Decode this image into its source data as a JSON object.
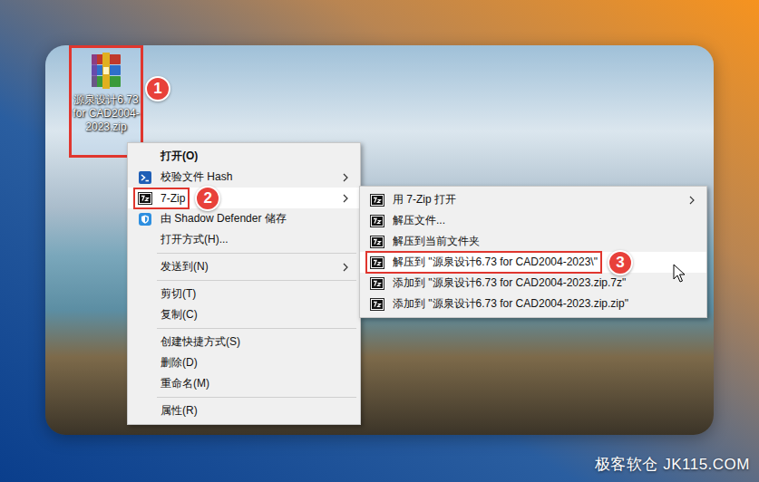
{
  "desktop_icon": {
    "label": "源泉设计6.73 for CAD2004-2023.zip",
    "selected": true,
    "badge": "1"
  },
  "context_menu": {
    "items": [
      {
        "kind": "plain",
        "label": "打开(O)",
        "bold": true,
        "submenu": false,
        "selected": false
      },
      {
        "kind": "hash",
        "label": "校验文件 Hash",
        "bold": false,
        "submenu": true,
        "selected": false
      },
      {
        "kind": "zip",
        "label": "7-Zip",
        "bold": false,
        "submenu": true,
        "selected": true,
        "badge": "2"
      },
      {
        "kind": "shield",
        "label": "由 Shadow Defender 储存",
        "bold": false,
        "submenu": false,
        "selected": false
      },
      {
        "kind": "plain",
        "label": "打开方式(H)...",
        "bold": false,
        "submenu": false,
        "selected": false
      },
      {
        "kind": "separator"
      },
      {
        "kind": "plain",
        "label": "发送到(N)",
        "bold": false,
        "submenu": true,
        "selected": false
      },
      {
        "kind": "separator"
      },
      {
        "kind": "plain",
        "label": "剪切(T)",
        "bold": false,
        "submenu": false,
        "selected": false
      },
      {
        "kind": "plain",
        "label": "复制(C)",
        "bold": false,
        "submenu": false,
        "selected": false
      },
      {
        "kind": "separator"
      },
      {
        "kind": "plain",
        "label": "创建快捷方式(S)",
        "bold": false,
        "submenu": false,
        "selected": false
      },
      {
        "kind": "plain",
        "label": "删除(D)",
        "bold": false,
        "submenu": false,
        "selected": false
      },
      {
        "kind": "plain",
        "label": "重命名(M)",
        "bold": false,
        "submenu": false,
        "selected": false
      },
      {
        "kind": "separator"
      },
      {
        "kind": "plain",
        "label": "属性(R)",
        "bold": false,
        "submenu": false,
        "selected": false
      }
    ]
  },
  "submenu": {
    "items": [
      {
        "kind": "zip",
        "label": "用 7-Zip 打开",
        "bold": false,
        "submenu": true,
        "selected": false
      },
      {
        "kind": "zip",
        "label": "解压文件...",
        "bold": false,
        "submenu": false,
        "selected": false
      },
      {
        "kind": "zip",
        "label": "解压到当前文件夹",
        "bold": false,
        "submenu": false,
        "selected": false
      },
      {
        "kind": "zip",
        "label": "解压到 \"源泉设计6.73 for CAD2004-2023\\\"",
        "bold": false,
        "submenu": false,
        "selected": true,
        "badge": "3"
      },
      {
        "kind": "zip",
        "label": "添加到 \"源泉设计6.73 for CAD2004-2023.zip.7z\"",
        "bold": false,
        "submenu": false,
        "selected": false
      },
      {
        "kind": "zip",
        "label": "添加到 \"源泉设计6.73 for CAD2004-2023.zip.zip\"",
        "bold": false,
        "submenu": false,
        "selected": false
      }
    ]
  },
  "watermark": "极客软仓 JK115.COM"
}
